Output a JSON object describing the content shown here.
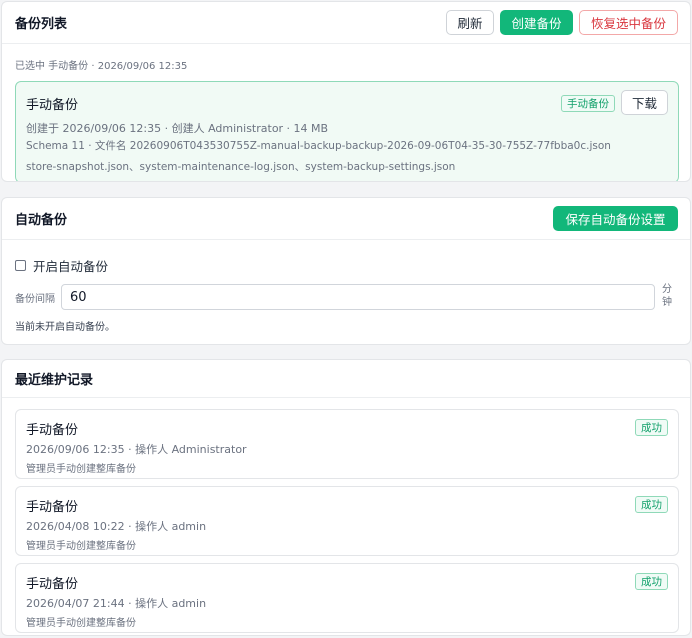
{
  "backup_list": {
    "title": "备份列表",
    "refresh_label": "刷新",
    "create_label": "创建备份",
    "restore_label": "恢复选中备份",
    "selected_text": "已选中 手动备份 · 2026/09/06 12:35",
    "selected_backup": {
      "name": "手动备份",
      "badge": "手动备份",
      "download_label": "下载",
      "meta": "创建于 2026/09/06 12:35 · 创建人 Administrator · 14 MB",
      "schema_file": "Schema 11 · 文件名 20260906T043530755Z-manual-backup-backup-2026-09-06T04-35-30-755Z-77fbba0c.json",
      "files": "store-snapshot.json、system-maintenance-log.json、system-backup-settings.json"
    }
  },
  "auto_backup": {
    "title": "自动备份",
    "save_label": "保存自动备份设置",
    "enable_label": "开启自动备份",
    "enabled": false,
    "interval_label": "备份间隔",
    "interval_value": "60",
    "interval_unit_1": "分",
    "interval_unit_2": "钟",
    "status_text": "当前未开启自动备份。"
  },
  "maintenance": {
    "title": "最近维护记录",
    "records": [
      {
        "title": "手动备份",
        "status": "成功",
        "meta": "2026/09/06 12:35 · 操作人 Administrator",
        "desc": "管理员手动创建整库备份"
      },
      {
        "title": "手动备份",
        "status": "成功",
        "meta": "2026/04/08 10:22 · 操作人 admin",
        "desc": "管理员手动创建整库备份"
      },
      {
        "title": "手动备份",
        "status": "成功",
        "meta": "2026/04/07 21:44 · 操作人 admin",
        "desc": "管理员手动创建整库备份"
      }
    ]
  },
  "colors": {
    "accent": "#12b77a",
    "danger": "#d9363e",
    "success_tag": "#12a16b",
    "selected_bg": "#f1faf5",
    "selected_border": "#8fd9b8"
  }
}
